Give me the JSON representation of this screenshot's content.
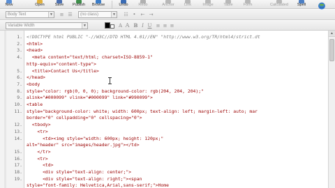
{
  "toolbar": {
    "buttons": [
      {
        "name": "new-button",
        "label": "New",
        "icon": "new-file-icon",
        "color": "#5a8fd6",
        "enabled": true
      },
      {
        "name": "open-button",
        "label": "Open",
        "icon": "folder-open-icon",
        "color": "#e2b13c",
        "enabled": true
      },
      {
        "name": "save-button",
        "label": "Save",
        "icon": "save-icon",
        "color": "#4a6fb0",
        "enabled": true
      },
      {
        "name": "publish-button",
        "label": "Publish",
        "icon": "publish-icon",
        "color": "#3d8f4a",
        "enabled": true
      },
      {
        "name": "browse-button",
        "label": "Browse",
        "icon": "globe-icon",
        "color": "#3a7cc8",
        "enabled": true
      },
      {
        "name": "undo-button",
        "label": "Undo",
        "icon": "undo-icon",
        "color": "#3a6cb5",
        "enabled": true
      },
      {
        "name": "redo-button",
        "label": "Redo",
        "icon": "redo-icon",
        "color": "#b0b0b0",
        "enabled": false
      },
      {
        "name": "anchor-button",
        "label": "Anchor",
        "icon": "anchor-icon",
        "color": "#b8b8b8",
        "enabled": false
      },
      {
        "name": "link-button",
        "label": "Link",
        "icon": "link-icon",
        "color": "#b8b8b8",
        "enabled": false
      },
      {
        "name": "image-button",
        "label": "Image",
        "icon": "image-icon",
        "color": "#b8b8b8",
        "enabled": false
      },
      {
        "name": "table-button",
        "label": "Table",
        "icon": "table-icon",
        "color": "#b8b8b8",
        "enabled": false
      },
      {
        "name": "form-button",
        "label": "Form",
        "icon": "form-icon",
        "color": "#b8b8b8",
        "enabled": false
      },
      {
        "name": "calculated-button",
        "label": "Calculated",
        "icon": "calculator-icon",
        "color": "#b8b8b8",
        "enabled": false
      },
      {
        "name": "spell-button",
        "label": "Spell",
        "icon": "spellcheck-icon",
        "color": "#4c7fc4",
        "enabled": true
      }
    ]
  },
  "format_bar_1": {
    "style_select": "Body Text",
    "font_select": "(no class)"
  },
  "format_bar_2": {
    "width_select": "Variable Width",
    "text_color": "#000000",
    "highlight_color": "#ffffff"
  },
  "editor": {
    "lines": [
      {
        "n": "1.",
        "text": "<!DOCTYPE html PUBLIC \"-//W3C//DTD HTML 4.01//EN\" \"http://www.w3.org/TR/html4/strict.dt",
        "kind": "comment"
      },
      {
        "n": "2.",
        "text": "<html>",
        "kind": "tag"
      },
      {
        "n": "3.",
        "text": "<head>",
        "kind": "tag"
      },
      {
        "n": "4.",
        "text": "  <meta content=\"text/html; charset=ISO-8859-1\"",
        "kind": "tag"
      },
      {
        "n": "",
        "text": "http-equiv=\"content-type\">",
        "kind": "tag"
      },
      {
        "n": "5.",
        "text": "  <title>Contact Us</title>",
        "kind": "tag"
      },
      {
        "n": "6.",
        "text": "</head>",
        "kind": "tag"
      },
      {
        "n": "7.",
        "text": "<body",
        "kind": "tag"
      },
      {
        "n": "8.",
        "text": "style=\"color: rgb(0, 0, 0); background-color: rgb(204, 204, 204);\"",
        "kind": "tag"
      },
      {
        "n": "9.",
        "text": "alink=\"#000099\" vlink=\"#000099\" link=\"#990099\">",
        "kind": "tag"
      },
      {
        "n": "10.",
        "text": "<table",
        "kind": "tag"
      },
      {
        "n": "11.",
        "text": "style=\"background-color: white; width: 600px; text-align: left; margin-left: auto; mar",
        "kind": "tag"
      },
      {
        "n": "",
        "text": "border=\"0\" cellpadding=\"0\" cellspacing=\"0\">",
        "kind": "tag"
      },
      {
        "n": "12.",
        "text": "  <tbody>",
        "kind": "tag"
      },
      {
        "n": "13.",
        "text": "    <tr>",
        "kind": "tag"
      },
      {
        "n": "14.",
        "text": "      <td><img style=\"width: 600px; height: 120px;\"",
        "kind": "tag"
      },
      {
        "n": "",
        "text": "alt=\"header\" src=\"images/header.jpg\"></td>",
        "kind": "tag"
      },
      {
        "n": "15.",
        "text": "    </tr>",
        "kind": "tag"
      },
      {
        "n": "16.",
        "text": "    <tr>",
        "kind": "tag"
      },
      {
        "n": "17.",
        "text": "      <td>",
        "kind": "tag"
      },
      {
        "n": "18.",
        "text": "      <div style=\"text-align: center;\">",
        "kind": "tag"
      },
      {
        "n": "19.",
        "text": "      <div style=\"text-align: right;\"><span",
        "kind": "tag"
      },
      {
        "n": "",
        "text": "style=\"font-family: Helvetica,Arial,sans-serif;\">Home",
        "kind": "tag"
      }
    ]
  }
}
